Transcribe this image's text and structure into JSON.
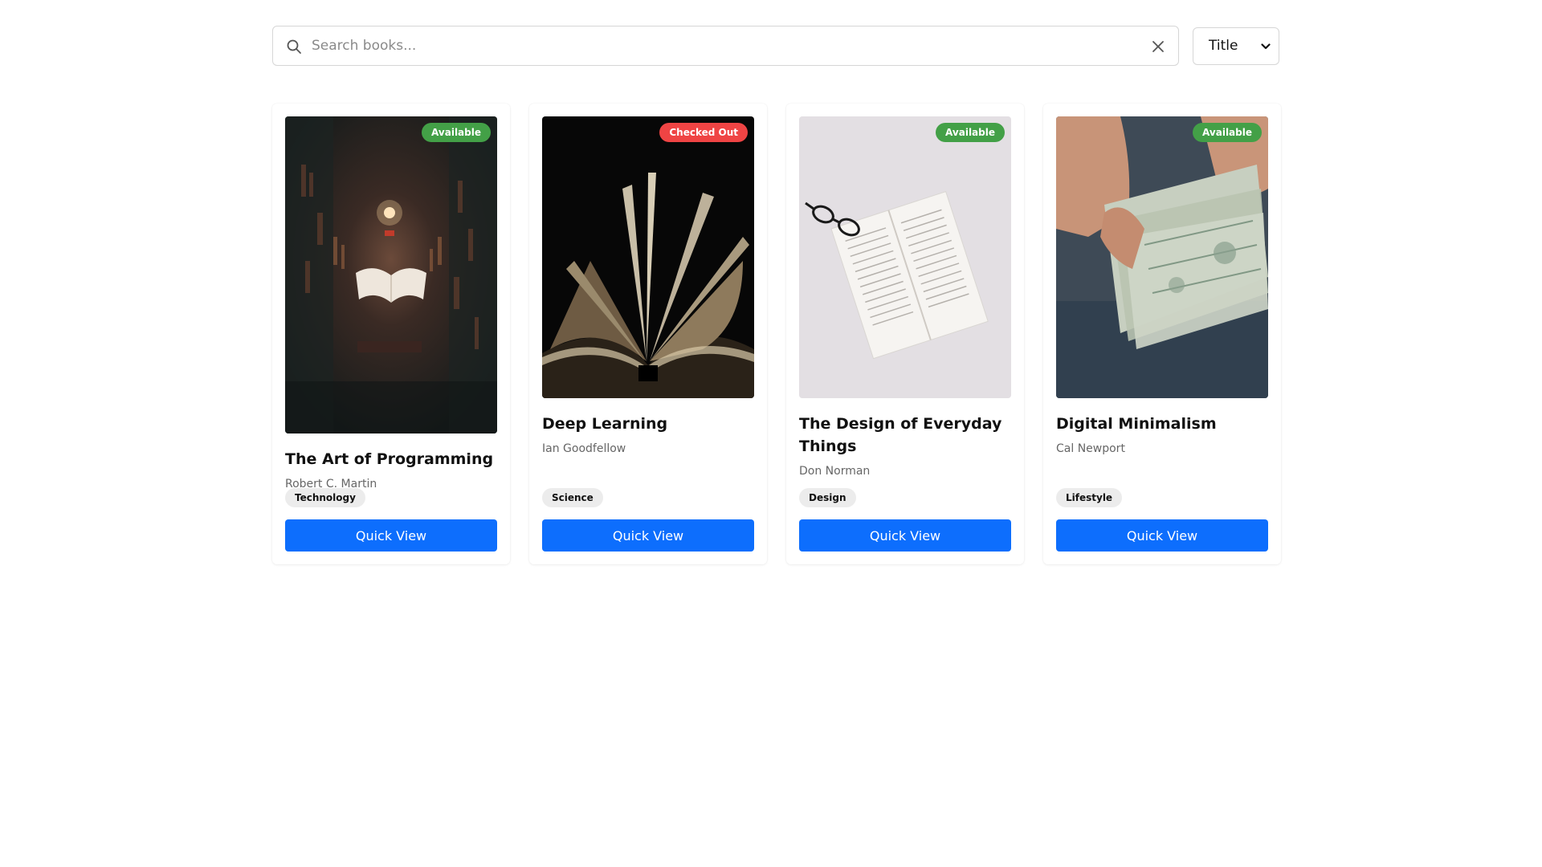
{
  "search": {
    "placeholder": "Search books...",
    "value": ""
  },
  "sort": {
    "selected": "Title"
  },
  "books": [
    {
      "title": "The Art of Programming",
      "author": "Robert C. Martin",
      "status": "Available",
      "category": "Technology",
      "action": "Quick View"
    },
    {
      "title": "Deep Learning",
      "author": "Ian Goodfellow",
      "status": "Checked Out",
      "category": "Science",
      "action": "Quick View"
    },
    {
      "title": "The Design of Everyday Things",
      "author": "Don Norman",
      "status": "Available",
      "category": "Design",
      "action": "Quick View"
    },
    {
      "title": "Digital Minimalism",
      "author": "Cal Newport",
      "status": "Available",
      "category": "Lifestyle",
      "action": "Quick View"
    }
  ],
  "colors": {
    "accent": "#0d6efd",
    "available": "#43a047",
    "checked_out": "#ef4444"
  },
  "icons": {
    "search": "search-icon",
    "clear": "close-icon",
    "sort": "chevron-down-icon"
  }
}
